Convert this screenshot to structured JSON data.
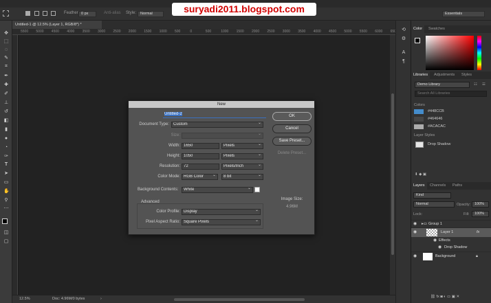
{
  "watermark": "suryadi2011.blogspot.com",
  "options_bar": {
    "feather_label": "Feather:",
    "feather_value": "0 px",
    "antialias_label": "Anti-alias",
    "style_label": "Style:",
    "style_value": "Normal",
    "workspace": "Essentials"
  },
  "document": {
    "tab_title": "Untitled-1 @ 12.5% (Layer 1, RGB/8*) *",
    "zoom": "12.5%",
    "doc_size": "Doc: 4.96M/0 bytes"
  },
  "ruler_ticks": [
    "5500",
    "5000",
    "4500",
    "4000",
    "3500",
    "3000",
    "2500",
    "2000",
    "1500",
    "1000",
    "500",
    "0",
    "500",
    "1000",
    "1500",
    "2000",
    "2500",
    "3000",
    "3500",
    "4000",
    "4500",
    "5000",
    "5500",
    "6000",
    "6500"
  ],
  "panels": {
    "color_tabs": [
      "Color",
      "Swatches"
    ],
    "lib_tabs": [
      "Libraries",
      "Adjustments",
      "Styles"
    ],
    "library_name": "Demo Library",
    "library_search": "Search All Libraries",
    "colors_header": "Colors",
    "colors": [
      {
        "hex": "#448CCB",
        "label": "#448CCB"
      },
      {
        "hex": "#464646",
        "label": "#464646"
      },
      {
        "hex": "#ACACAC",
        "label": "#ACACAC"
      }
    ],
    "layer_styles_header": "Layer Styles",
    "layer_style_item": "Drop Shadow",
    "layer_tabs": [
      "Layers",
      "Channels",
      "Paths"
    ],
    "kind": "Kind",
    "blend_mode": "Normal",
    "opacity_label": "Opacity:",
    "opacity_value": "100%",
    "lock_label": "Lock:",
    "fill_label": "Fill:",
    "fill_value": "100%",
    "layers": {
      "group": "Group 1",
      "layer1": "Layer 1",
      "effects": "Effects",
      "drop_shadow": "Drop Shadow",
      "background": "Background",
      "fx": "fx"
    }
  },
  "dialog": {
    "title": "New",
    "name_label": "Name:",
    "name_value": "Untitled-2",
    "doc_type_label": "Document Type:",
    "doc_type_value": "Custom",
    "size_label": "Size:",
    "width_label": "Width:",
    "width_value": "1650",
    "width_unit": "Pixels",
    "height_label": "Height:",
    "height_value": "1050",
    "height_unit": "Pixels",
    "resolution_label": "Resolution:",
    "resolution_value": "72",
    "resolution_unit": "Pixels/Inch",
    "color_mode_label": "Color Mode:",
    "color_mode_value": "RGB Color",
    "bit_depth": "8 bit",
    "bg_contents_label": "Background Contents:",
    "bg_contents_value": "White",
    "advanced_label": "Advanced",
    "color_profile_label": "Color Profile:",
    "color_profile_value": "Display",
    "pixel_aspect_label": "Pixel Aspect Ratio:",
    "pixel_aspect_value": "Square Pixels",
    "ok": "OK",
    "cancel": "Cancel",
    "save_preset": "Save Preset...",
    "delete_preset": "Delete Preset...",
    "image_size_label": "Image Size:",
    "image_size_value": "4.96M"
  }
}
